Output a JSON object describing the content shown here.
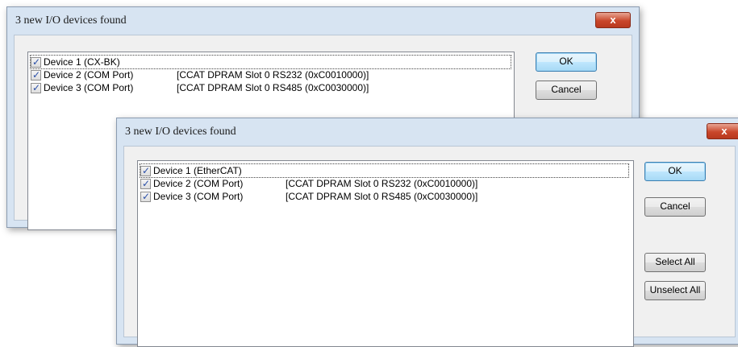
{
  "dialog_back": {
    "title": "3 new I/O devices found",
    "close_label": "x",
    "devices": [
      {
        "name": "Device 1 (CX-BK)",
        "slot": ""
      },
      {
        "name": "Device 2 (COM Port)",
        "slot": "[CCAT DPRAM Slot 0 RS232 (0xC0010000)]"
      },
      {
        "name": "Device 3 (COM Port)",
        "slot": "[CCAT DPRAM Slot 0 RS485 (0xC0030000)]"
      }
    ],
    "ok_label": "OK",
    "cancel_label": "Cancel"
  },
  "dialog_front": {
    "title": "3 new I/O devices found",
    "close_label": "x",
    "devices": [
      {
        "name": "Device 1 (EtherCAT)",
        "slot": ""
      },
      {
        "name": "Device 2 (COM Port)",
        "slot": "[CCAT DPRAM Slot 0 RS232 (0xC0010000)]"
      },
      {
        "name": "Device 3 (COM Port)",
        "slot": "[CCAT DPRAM Slot 0 RS485 (0xC0030000)]"
      }
    ],
    "ok_label": "OK",
    "cancel_label": "Cancel",
    "select_all_label": "Select All",
    "unselect_all_label": "Unselect All"
  },
  "colors": {
    "frame": "#d7e4f2",
    "close_button": "#c9472b",
    "default_button": "#bee6fd",
    "checkmark": "#2a4fa8"
  }
}
